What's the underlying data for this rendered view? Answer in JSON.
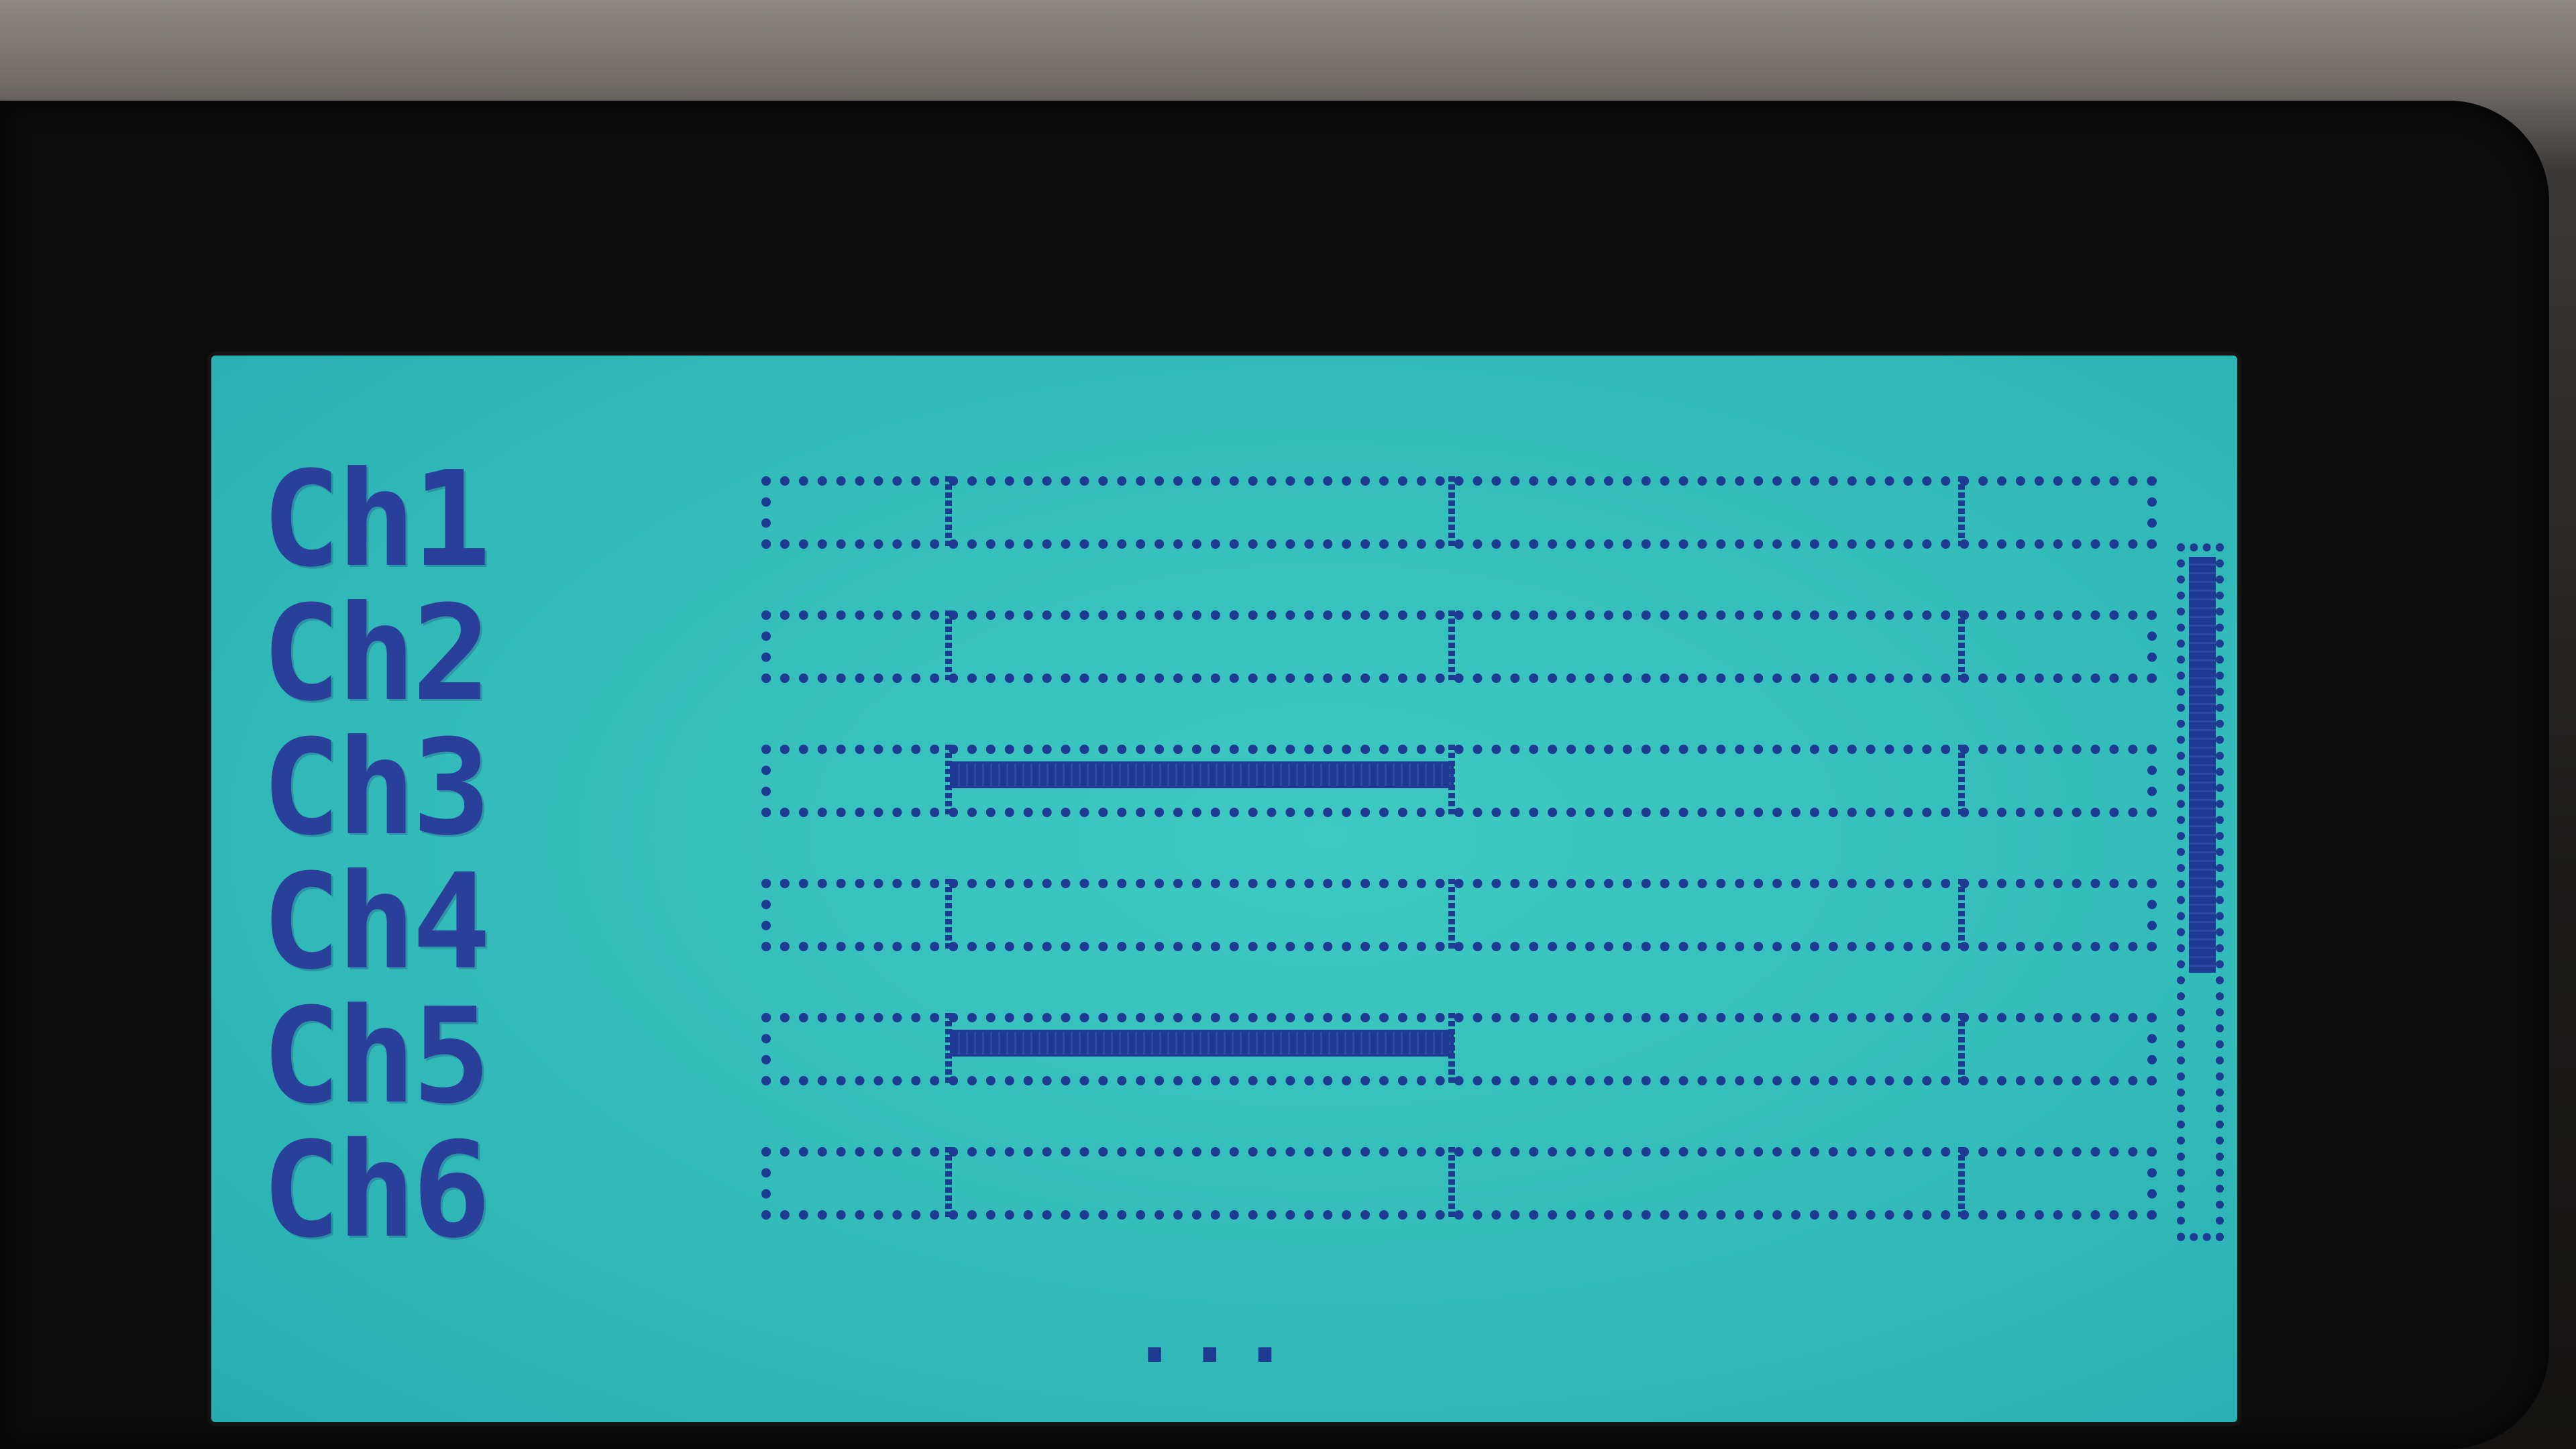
{
  "channels": [
    {
      "label": "Ch1",
      "fill": 0.0
    },
    {
      "label": "Ch2",
      "fill": 0.0
    },
    {
      "label": "Ch3",
      "fill": 0.37
    },
    {
      "label": "Ch4",
      "fill": 0.0
    },
    {
      "label": "Ch5",
      "fill": 0.37
    },
    {
      "label": "Ch6",
      "fill": 0.0
    }
  ],
  "more_indicator": "...",
  "scroll_position": 0.0,
  "colors": {
    "lcd_background": "#35bfbb",
    "pixel_foreground": "#1f3a92"
  }
}
